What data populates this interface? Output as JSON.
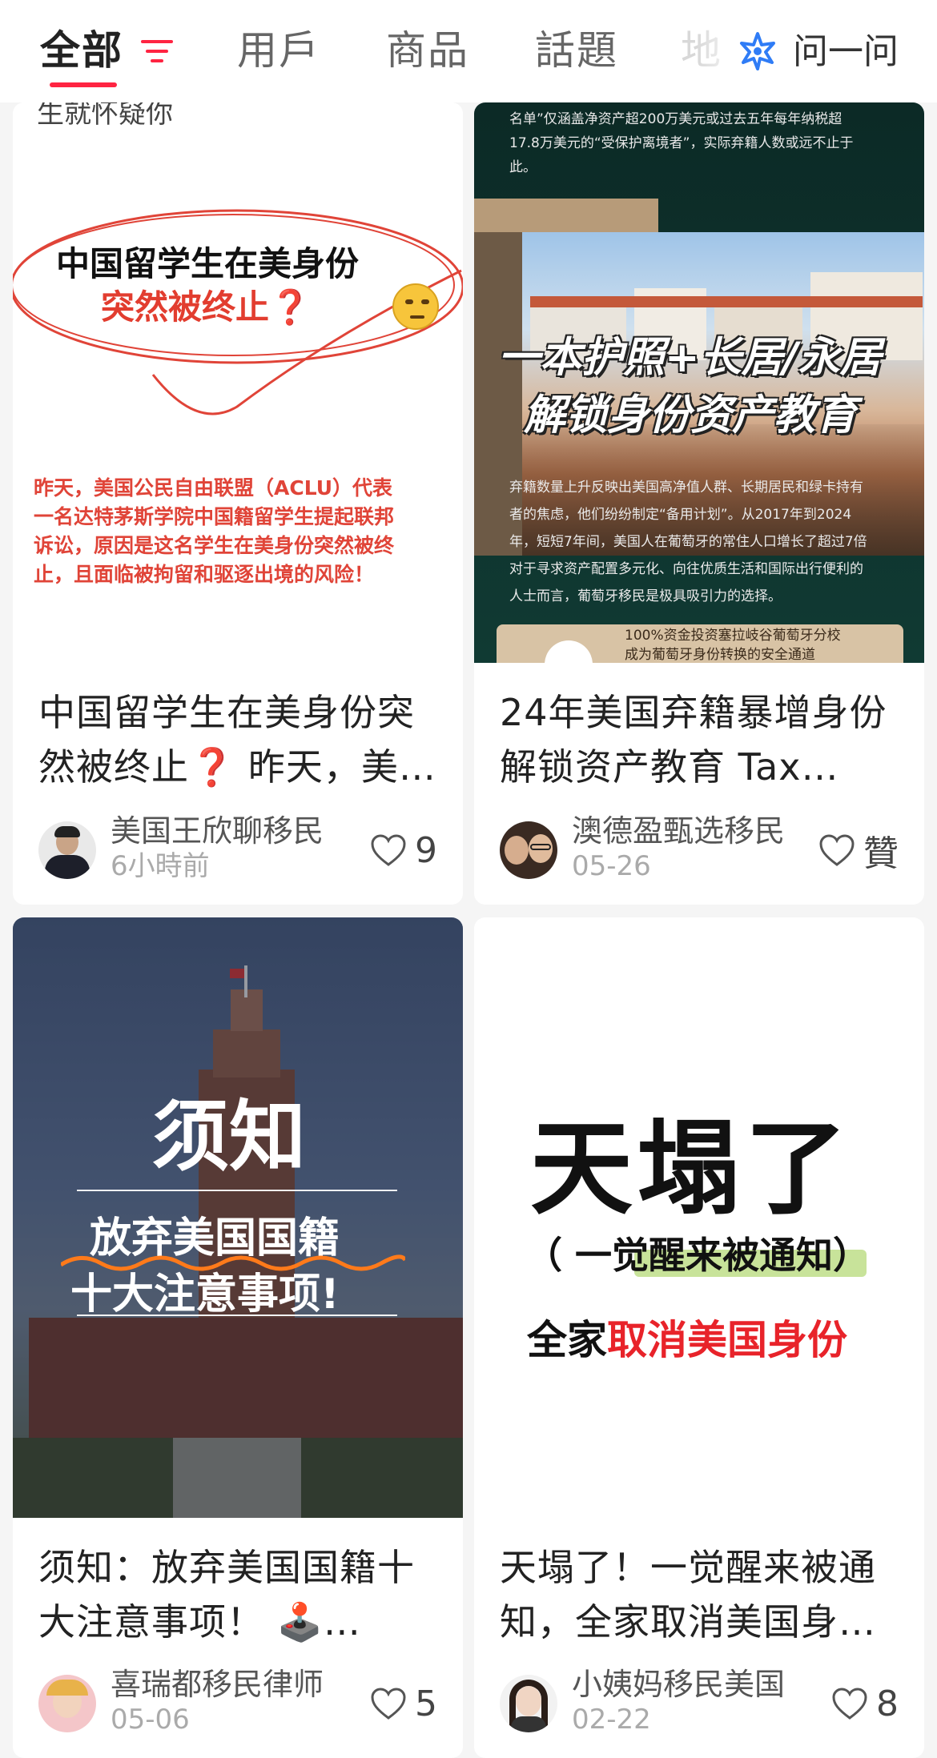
{
  "tabs": [
    {
      "label": "全部"
    },
    {
      "label": "用戶"
    },
    {
      "label": "商品"
    },
    {
      "label": "話題"
    },
    {
      "label": "地"
    }
  ],
  "ask": {
    "label": "问一问"
  },
  "colors": {
    "accent": "#ff2442",
    "ask_icon": "#2f7cf6"
  },
  "cards": [
    {
      "cover": {
        "top_cut": "生就怀疑你",
        "headline1": "中国留学生在美身份",
        "headline2": "突然被终止❓",
        "body": [
          "昨天，美国公民自由联盟（ACLU）代表",
          "一名达特茅斯学院中国籍留学生提起联邦",
          "诉讼，原因是这名学生在美身份突然被终",
          "止，且面临被拘留和驱逐出境的风险！"
        ]
      },
      "title": "中国留学生在美身份突然被终止❓ 昨天，美国公民自由联盟（ACLU）代表…",
      "author": "美国王欣聊移民",
      "date": "6小時前",
      "likes": "9"
    },
    {
      "cover": {
        "top_text": [
          "名单”仅涵盖净资产超200万美元或过去五年每年纳税超",
          "17.8万美元的“受保护离境者”，实际弃籍人数或远不止于",
          "此。"
        ],
        "headline1": "一本护照+长居/永居",
        "headline2": "解锁身份资产教育",
        "body": [
          "弃籍数量上升反映出美国高净值人群、长期居民和绿卡持有",
          "者的焦虑，他们纷纷制定“备用计划”。从2017年到2024",
          "年，短短7年间，美国人在葡萄牙的常住人口增长了超过7倍",
          "对于寻求资产配置多元化、向往优质生活和国际出行便利的",
          "人士而言，葡萄牙移民是极具吸引力的选择。"
        ],
        "bottom_text": [
          "100%资金投资塞拉岐谷葡萄牙分校",
          "成为葡萄牙身份转换的安全通道"
        ]
      },
      "title": "24年美国弃籍暴增身份解锁资产教育 Tax…",
      "author": "澳德盈甄选移民",
      "date": "05-26",
      "likes": "贊"
    },
    {
      "cover": {
        "headline1": "须知",
        "headline2": "放弃美国国籍",
        "headline3": "十大注意事项!"
      },
      "title": "须知：放弃美国国籍十大注意事项！ 🕹️…",
      "author": "喜瑞都移民律师",
      "date": "05-06",
      "likes": "5"
    },
    {
      "cover": {
        "headline1": "天塌了",
        "subline": "（ 一觉醒来被通知）",
        "line3_black": "全家",
        "line3_red": "取消美国身份"
      },
      "title": "天塌了！一觉醒来被通知，全家取消美国身份…",
      "author": "小姨妈移民美国",
      "date": "02-22",
      "likes": "8"
    }
  ]
}
